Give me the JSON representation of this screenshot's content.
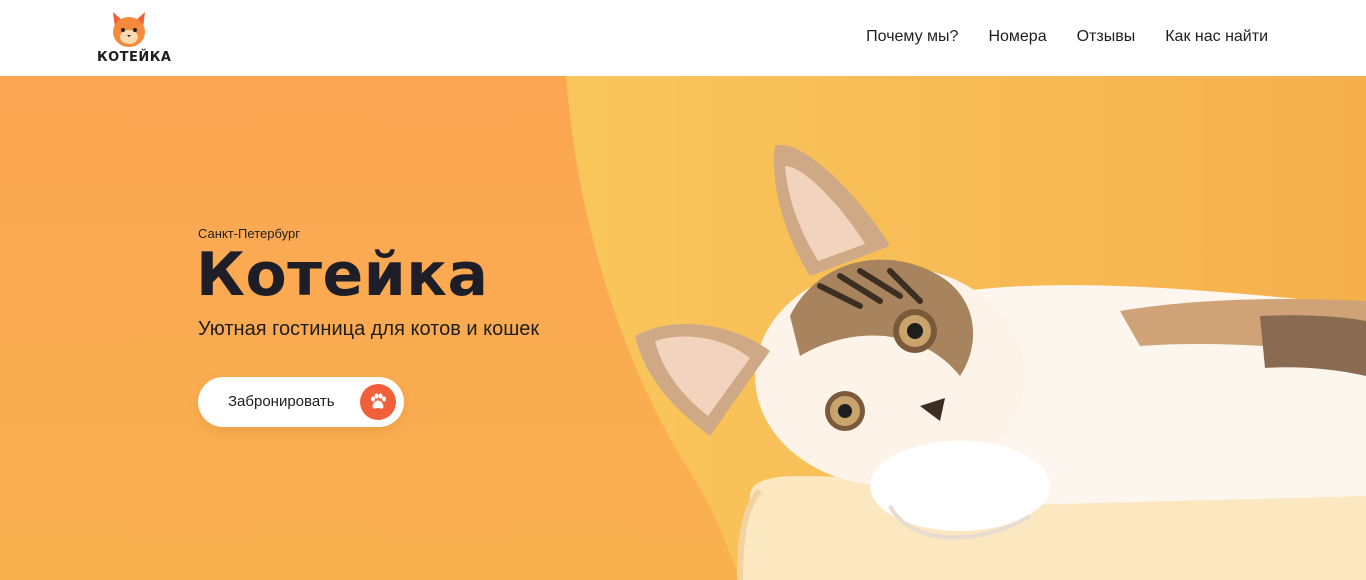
{
  "header": {
    "logo_text": "КОТЕЙКА",
    "nav": [
      {
        "label": "Почему мы?"
      },
      {
        "label": "Номера"
      },
      {
        "label": "Отзывы"
      },
      {
        "label": "Как нас найти"
      }
    ]
  },
  "hero": {
    "city": "Санкт-Петербург",
    "title": "Котейка",
    "subtitle": "Уютная гостиница для котов и кошек",
    "cta_label": "Забронировать",
    "cta_icon": "paw-icon"
  },
  "colors": {
    "accent": "#f2603a",
    "hero_orange": "#f9b854",
    "text_dark": "#1e1e28"
  }
}
